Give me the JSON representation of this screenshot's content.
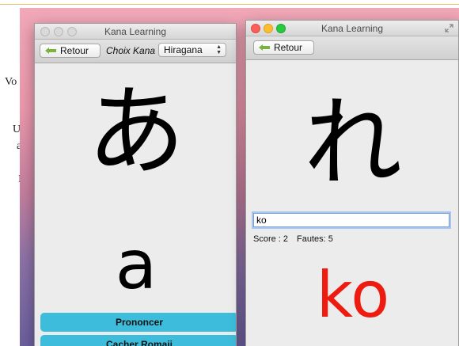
{
  "background": {
    "text_fragments": [
      "Vo",
      "U",
      "a",
      "I"
    ]
  },
  "window_left": {
    "title": "Kana Learning",
    "back_label": "Retour",
    "choice_label": "Choix Kana",
    "kana_select_value": "Hiragana",
    "kana_character": "あ",
    "romaji": "a",
    "pronounce_label": "Prononcer",
    "hide_romaji_label": "Cacher Romaji"
  },
  "window_right": {
    "title": "Kana Learning",
    "back_label": "Retour",
    "kana_character": "れ",
    "answer_value": "ko",
    "score_text": "Score : 2",
    "faults_text": "Fautes: 5",
    "answer_feedback": "ko"
  },
  "colors": {
    "accent_button": "#3dbcdb",
    "feedback_wrong": "#ee1c10",
    "arrow_green": "#7ab33d"
  }
}
